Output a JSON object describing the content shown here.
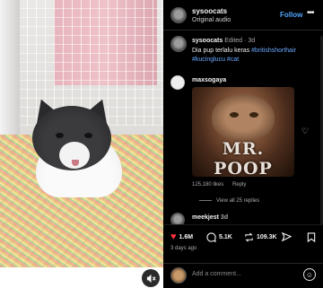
{
  "header": {
    "username": "sysoocats",
    "audio": "Original audio",
    "follow_label": "Follow",
    "more_icon": "more-horizontal-icon"
  },
  "caption": {
    "username": "sysoocats",
    "edited": "Edited",
    "dot": "·",
    "age": "3d",
    "text": "Dia pup terlalu keras",
    "tags": [
      "#britishshorthair",
      "#kucinglucu",
      "#cat"
    ]
  },
  "comment": {
    "username": "maxsogaya",
    "image_text": "MR. POOP",
    "likes": "125,180 likes",
    "reply_label": "Reply",
    "view_replies": "View all 25 replies"
  },
  "comment2": {
    "username": "meekjest",
    "age": "3d"
  },
  "actions": {
    "likes": "1.6M",
    "comments": "5.1K",
    "reposts": "109.3K",
    "heart_color": "#ff3040"
  },
  "time_ago": "3 days ago",
  "add_comment_placeholder": "Add a comment...",
  "video": {
    "mute_icon": "speaker-muted-icon"
  }
}
